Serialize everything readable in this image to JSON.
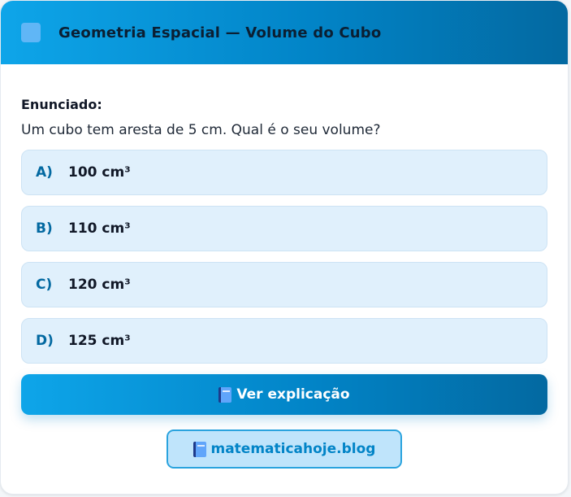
{
  "header": {
    "title": "Geometria Espacial — Volume do Cubo",
    "icon": "square-icon"
  },
  "statement": {
    "label": "Enunciado:",
    "text": "Um cubo tem aresta de 5 cm. Qual é o seu volume?"
  },
  "options": [
    {
      "letter": "A)",
      "text": "100 cm³"
    },
    {
      "letter": "B)",
      "text": "110 cm³"
    },
    {
      "letter": "C)",
      "text": "120 cm³"
    },
    {
      "letter": "D)",
      "text": "125 cm³"
    }
  ],
  "explain_button": {
    "icon": "book-icon",
    "label": "Ver explicação"
  },
  "site_link": {
    "icon": "book-icon",
    "label": "matematicahoje.blog"
  },
  "colors": {
    "accent": "#0284c7",
    "accent_dark": "#0369a1",
    "option_bg": "#e0f0fc",
    "link_bg": "#bfe4fb"
  }
}
